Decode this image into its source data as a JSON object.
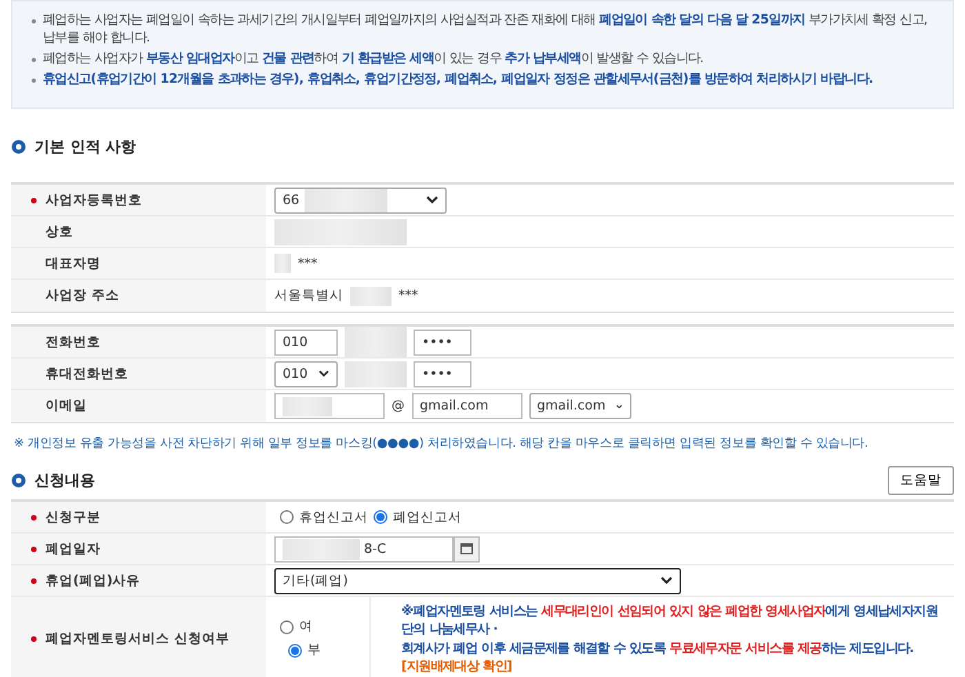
{
  "notices": [
    [
      {
        "kind": "plain",
        "text": "폐업하는 사업자는 폐업일이 속하는 과세기간의 개시일부터 폐업일까지의 사업실적과 잔존 재화에 대해 "
      },
      {
        "kind": "blue",
        "text": "폐업일이 속한 달의 다음 달 25일까지"
      },
      {
        "kind": "plain",
        "text": " 부가가치세 확정 신고, 납부를 해야 합니다."
      }
    ],
    [
      {
        "kind": "plain",
        "text": "폐업하는 사업자가 "
      },
      {
        "kind": "blue",
        "text": "부동산 임대업자"
      },
      {
        "kind": "plain",
        "text": "이고 "
      },
      {
        "kind": "blue",
        "text": "건물 관련"
      },
      {
        "kind": "plain",
        "text": "하여 "
      },
      {
        "kind": "blue",
        "text": "기 환급받은 세액"
      },
      {
        "kind": "plain",
        "text": "이 있는 경우 "
      },
      {
        "kind": "blue",
        "text": "추가 납부세액"
      },
      {
        "kind": "plain",
        "text": "이 발생할 수 있습니다."
      }
    ],
    [
      {
        "kind": "blue",
        "text": "휴업신고(휴업기간이 12개월을 초과하는 경우), 휴업취소, 휴업기간정정, 폐업취소, 폐업일자 정정은 관할세무서(금천)를 방문하여 처리하시기 바랍니다."
      }
    ]
  ],
  "basic": {
    "title": "기본 인적 사항",
    "rows": [
      {
        "label": "사업자등록번호",
        "required": true,
        "kind": "select",
        "value": "66",
        "masked": true
      },
      {
        "label": "상호",
        "required": false,
        "kind": "masked"
      },
      {
        "label": "대표자명",
        "required": false,
        "kind": "text",
        "value": "***",
        "masked": true
      },
      {
        "label": "사업장 주소",
        "required": false,
        "kind": "text",
        "prefix": "서울특별시",
        "value": "***",
        "masked": true
      }
    ]
  },
  "contact": {
    "rows": [
      {
        "label": "전화번호",
        "kind": "phone",
        "first": "010",
        "first_select": false,
        "last": "••••"
      },
      {
        "label": "휴대전화번호",
        "kind": "phone",
        "first": "010",
        "first_select": true,
        "last": "••••"
      },
      {
        "label": "이메일",
        "kind": "email",
        "at": "@",
        "domain": "gmail.com",
        "domain_choice": "gmail.com"
      }
    ],
    "note": "※ 개인정보 유출 가능성을 사전 차단하기 위해 일부 정보를 마스킹(●●●●) 처리하였습니다. 해당 칸을 마우스로 클릭하면 입력된 정보를 확인할 수 있습니다."
  },
  "application": {
    "title": "신청내용",
    "help": "도움말",
    "type": {
      "label": "신청구분",
      "required": true,
      "options": [
        {
          "label": "휴업신고서",
          "selected": false
        },
        {
          "label": "폐업신고서",
          "selected": true
        }
      ]
    },
    "date": {
      "label": "폐업일자",
      "required": true,
      "value": "8-C"
    },
    "reason": {
      "label": "휴업(폐업)사유",
      "required": true,
      "value": "기타(폐업)"
    },
    "mentoring": {
      "label": "폐업자멘토링서비스 신청여부",
      "required": true,
      "options": [
        {
          "label": "여",
          "selected": false
        },
        {
          "label": "부",
          "selected": true
        }
      ],
      "lines": [
        [
          {
            "kind": "blue",
            "text": "※폐업자멘토링 서비스는 "
          },
          {
            "kind": "red",
            "text": "세무대리인이 선임되어 있지 않은 폐업한 영세사업자"
          },
          {
            "kind": "blue",
            "text": "에게 영세납세자지원단의 나눔세무사 ·"
          }
        ],
        [
          {
            "kind": "blue",
            "text": "회계사가 폐업 이후 세금문제를 해결할 수 있도록 "
          },
          {
            "kind": "red",
            "text": "무료세무자문 서비스를 제공"
          },
          {
            "kind": "blue",
            "text": "하는 제도입니다. "
          },
          {
            "kind": "link",
            "text": "[지원배제대상 확인]"
          }
        ]
      ]
    }
  }
}
